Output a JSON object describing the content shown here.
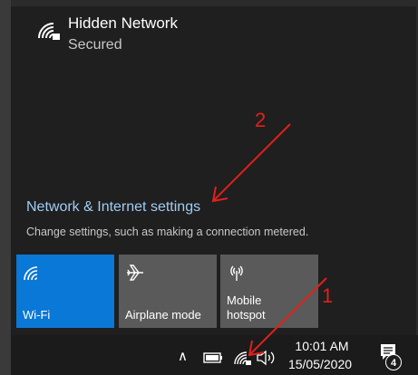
{
  "network": {
    "name": "Hidden Network",
    "status": "Secured"
  },
  "settings": {
    "link_label": "Network & Internet settings",
    "description": "Change settings, such as making a connection metered."
  },
  "quick_actions": [
    {
      "label": "Wi-Fi",
      "icon": "wifi-icon",
      "active": true
    },
    {
      "label": "Airplane mode",
      "icon": "airplane-icon",
      "active": false
    },
    {
      "label": "Mobile\nhotspot",
      "icon": "hotspot-icon",
      "active": false
    }
  ],
  "taskbar": {
    "time": "10:01 AM",
    "date": "15/05/2020",
    "notification_count": "4"
  },
  "annotations": {
    "step_1": "1",
    "step_2": "2"
  },
  "colors": {
    "accent": "#0a78d7",
    "link": "#9fcdf5",
    "annotation": "#e0211a"
  }
}
